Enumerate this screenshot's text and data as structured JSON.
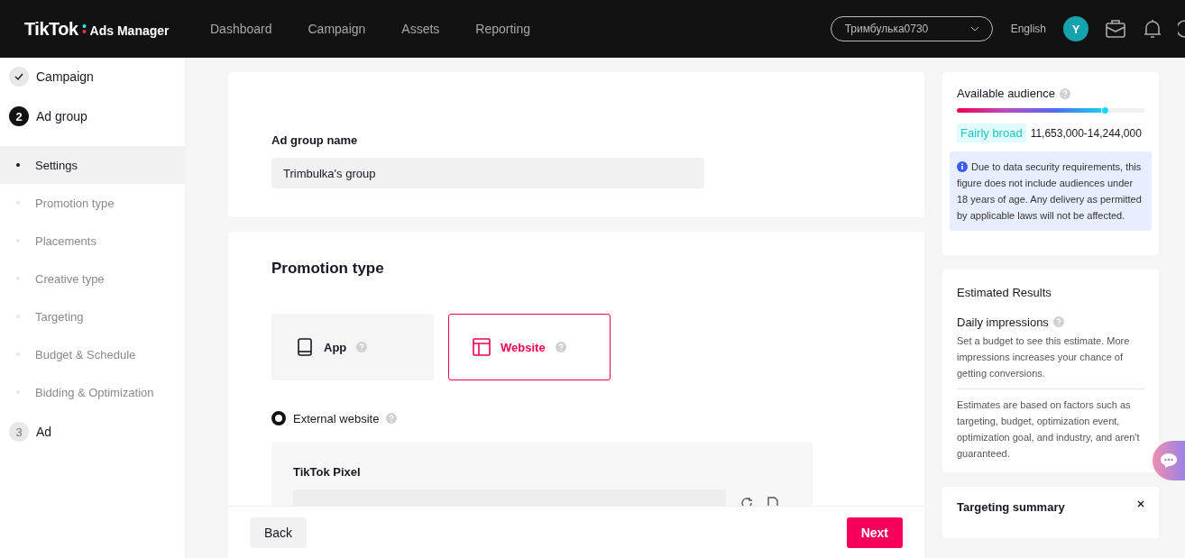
{
  "header": {
    "logo": {
      "brand": "TikTok",
      "product": "Ads Manager"
    },
    "nav": [
      {
        "label": "Dashboard"
      },
      {
        "label": "Campaign"
      },
      {
        "label": "Assets"
      },
      {
        "label": "Reporting"
      }
    ],
    "account": {
      "value": "Тримбулька0730"
    },
    "language": "English",
    "avatar": "Y"
  },
  "sidebar": {
    "steps": [
      {
        "kind": "done",
        "label": "Campaign"
      },
      {
        "kind": "current",
        "number": "2",
        "label": "Ad group",
        "items": [
          {
            "label": "Settings",
            "selected": true
          },
          {
            "label": "Promotion type",
            "selected": false
          },
          {
            "label": "Placements",
            "selected": false
          },
          {
            "label": "Creative type",
            "selected": false
          },
          {
            "label": "Targeting",
            "selected": false
          },
          {
            "label": "Budget & Schedule",
            "selected": false
          },
          {
            "label": "Bidding & Optimization",
            "selected": false
          }
        ]
      },
      {
        "kind": "pending",
        "number": "3",
        "label": "Ad"
      }
    ]
  },
  "ad_group_name": {
    "label": "Ad group name",
    "value": "Trimbulka's group"
  },
  "promotion_type": {
    "title": "Promotion type",
    "options": [
      {
        "kind": "app",
        "label": "App",
        "selected": false
      },
      {
        "kind": "website",
        "label": "Website",
        "selected": true
      }
    ],
    "destination": {
      "label": "External website",
      "selected": true
    },
    "pixel": {
      "label": "TikTok Pixel"
    }
  },
  "footer": {
    "back": "Back",
    "next": "Next"
  },
  "audience": {
    "title": "Available audience",
    "level": 0.79,
    "badge": "Fairly broad",
    "range": "11,653,000-14,244,000",
    "notice": "Due to data security requirements, this figure does not include audiences under 18 years of age. Any delivery as permitted by applicable laws will not be affected."
  },
  "estimated_results": {
    "title": "Estimated Results",
    "metric": "Daily impressions",
    "hint": "Set a budget to see this estimate. More impressions increases your chance of getting conversions.",
    "disclaimer": "Estimates are based on factors such as targeting, budget, optimization event, optimization goal, and industry, and aren't guaranteed."
  },
  "targeting_summary": {
    "title": "Targeting summary"
  }
}
